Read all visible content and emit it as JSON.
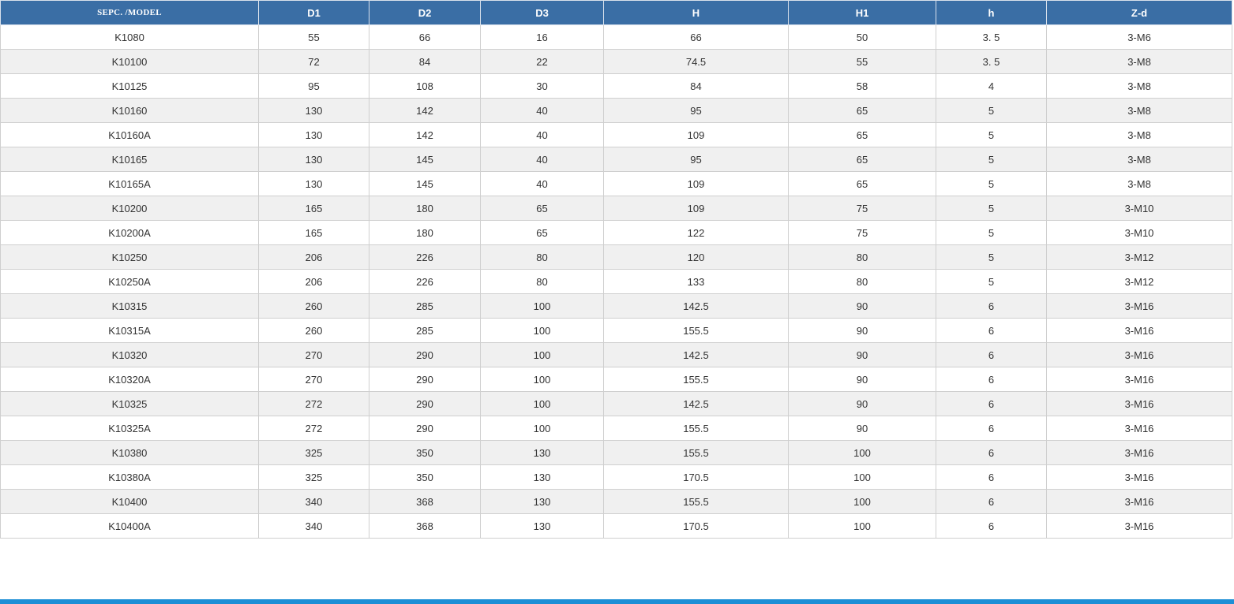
{
  "table": {
    "headers": [
      "SEPC. /MODEL",
      "D1",
      "D2",
      "D3",
      "H",
      "H1",
      "h",
      "Z-d"
    ],
    "rows": [
      [
        "K1080",
        "55",
        "66",
        "16",
        "66",
        "50",
        "3. 5",
        "3-M6"
      ],
      [
        "K10100",
        "72",
        "84",
        "22",
        "74.5",
        "55",
        "3. 5",
        "3-M8"
      ],
      [
        "K10125",
        "95",
        "108",
        "30",
        "84",
        "58",
        "4",
        "3-M8"
      ],
      [
        "K10160",
        "130",
        "142",
        "40",
        "95",
        "65",
        "5",
        "3-M8"
      ],
      [
        "K10160A",
        "130",
        "142",
        "40",
        "109",
        "65",
        "5",
        "3-M8"
      ],
      [
        "K10165",
        "130",
        "145",
        "40",
        "95",
        "65",
        "5",
        "3-M8"
      ],
      [
        "K10165A",
        "130",
        "145",
        "40",
        "109",
        "65",
        "5",
        "3-M8"
      ],
      [
        "K10200",
        "165",
        "180",
        "65",
        "109",
        "75",
        "5",
        "3-M10"
      ],
      [
        "K10200A",
        "165",
        "180",
        "65",
        "122",
        "75",
        "5",
        "3-M10"
      ],
      [
        "K10250",
        "206",
        "226",
        "80",
        "120",
        "80",
        "5",
        "3-M12"
      ],
      [
        "K10250A",
        "206",
        "226",
        "80",
        "133",
        "80",
        "5",
        "3-M12"
      ],
      [
        "K10315",
        "260",
        "285",
        "100",
        "142.5",
        "90",
        "6",
        "3-M16"
      ],
      [
        "K10315A",
        "260",
        "285",
        "100",
        "155.5",
        "90",
        "6",
        "3-M16"
      ],
      [
        "K10320",
        "270",
        "290",
        "100",
        "142.5",
        "90",
        "6",
        "3-M16"
      ],
      [
        "K10320A",
        "270",
        "290",
        "100",
        "155.5",
        "90",
        "6",
        "3-M16"
      ],
      [
        "K10325",
        "272",
        "290",
        "100",
        "142.5",
        "90",
        "6",
        "3-M16"
      ],
      [
        "K10325A",
        "272",
        "290",
        "100",
        "155.5",
        "90",
        "6",
        "3-M16"
      ],
      [
        "K10380",
        "325",
        "350",
        "130",
        "155.5",
        "100",
        "6",
        "3-M16"
      ],
      [
        "K10380A",
        "325",
        "350",
        "130",
        "170.5",
        "100",
        "6",
        "3-M16"
      ],
      [
        "K10400",
        "340",
        "368",
        "130",
        "155.5",
        "100",
        "6",
        "3-M16"
      ],
      [
        "K10400A",
        "340",
        "368",
        "130",
        "170.5",
        "100",
        "6",
        "3-M16"
      ]
    ]
  },
  "colors": {
    "header_background": "#3a6ea5",
    "header_text": "#ffffff",
    "stripe_row": "#f0f0f0",
    "bottom_bar": "#1d8fd6"
  }
}
